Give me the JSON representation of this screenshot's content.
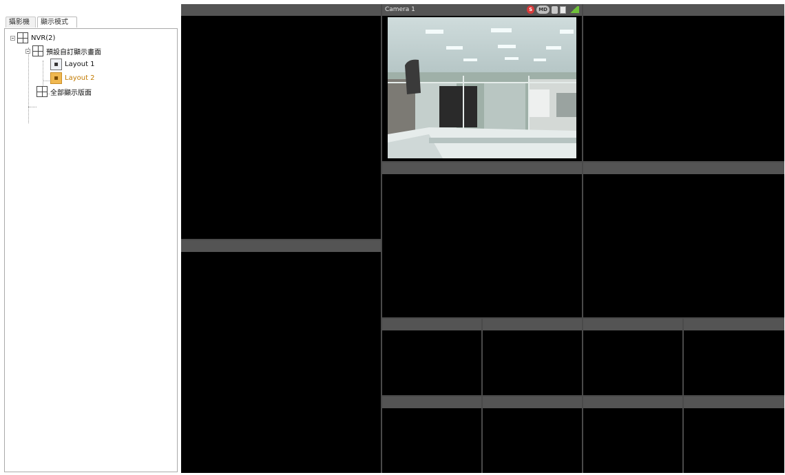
{
  "tabs": [
    {
      "label": "攝影機",
      "active": false
    },
    {
      "label": "顯示模式",
      "active": true
    }
  ],
  "tree": {
    "root": {
      "label": "NVR(2)",
      "icon": "grid-layout-icon"
    },
    "group": {
      "label": "預設自訂顯示畫面",
      "icon": "grid-layout-icon"
    },
    "layouts": [
      {
        "label": "Layout 1",
        "icon": "layout-icon",
        "selected": false
      },
      {
        "label": "Layout 2",
        "icon": "layout-icon",
        "selected": true
      }
    ],
    "fullscreen": {
      "label": "全部顯示版面",
      "icon": "grid-layout-icon"
    }
  },
  "camera": {
    "title": "Camera 1",
    "status": {
      "record": "S",
      "motion": "MD"
    }
  },
  "colors": {
    "wall_bg": "#4a4a4a",
    "cell_bar": "#545454",
    "selected_layout": "#f0b850",
    "signal": "#6fc13a",
    "record": "#d83a3a"
  }
}
